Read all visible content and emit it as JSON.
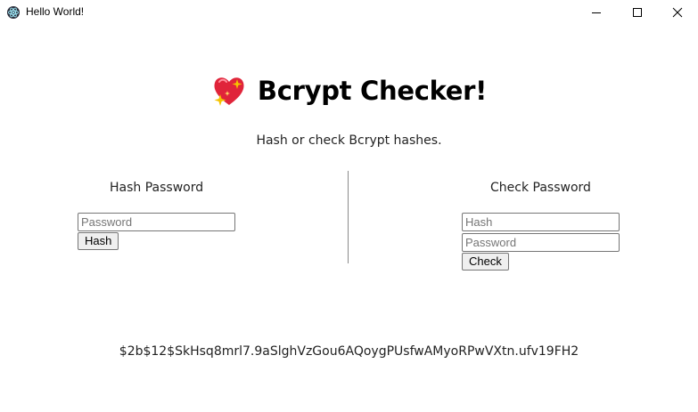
{
  "window": {
    "title": "Hello World!",
    "app_icon": "electron-atom-icon",
    "controls": [
      "minimize-icon",
      "maximize-icon",
      "close-icon"
    ]
  },
  "header": {
    "icon": "sparkling-heart-icon",
    "title": "Bcrypt Checker!",
    "subtitle": "Hash or check Bcrypt hashes."
  },
  "hash_section": {
    "title": "Hash Password",
    "password_placeholder": "Password",
    "password_value": "",
    "button_label": "Hash"
  },
  "check_section": {
    "title": "Check Password",
    "hash_placeholder": "Hash",
    "hash_value": "",
    "password_placeholder": "Password",
    "password_value": "",
    "button_label": "Check"
  },
  "result": {
    "text": "$2b$12$SkHsq8mrl7.9aSlghVzGou6AQoygPUsfwAMyoRPwVXtn.ufv19FH2"
  },
  "colors": {
    "heart": "#e0243a",
    "sparkle": "#f5c400",
    "divider": "#8a8a8a"
  }
}
